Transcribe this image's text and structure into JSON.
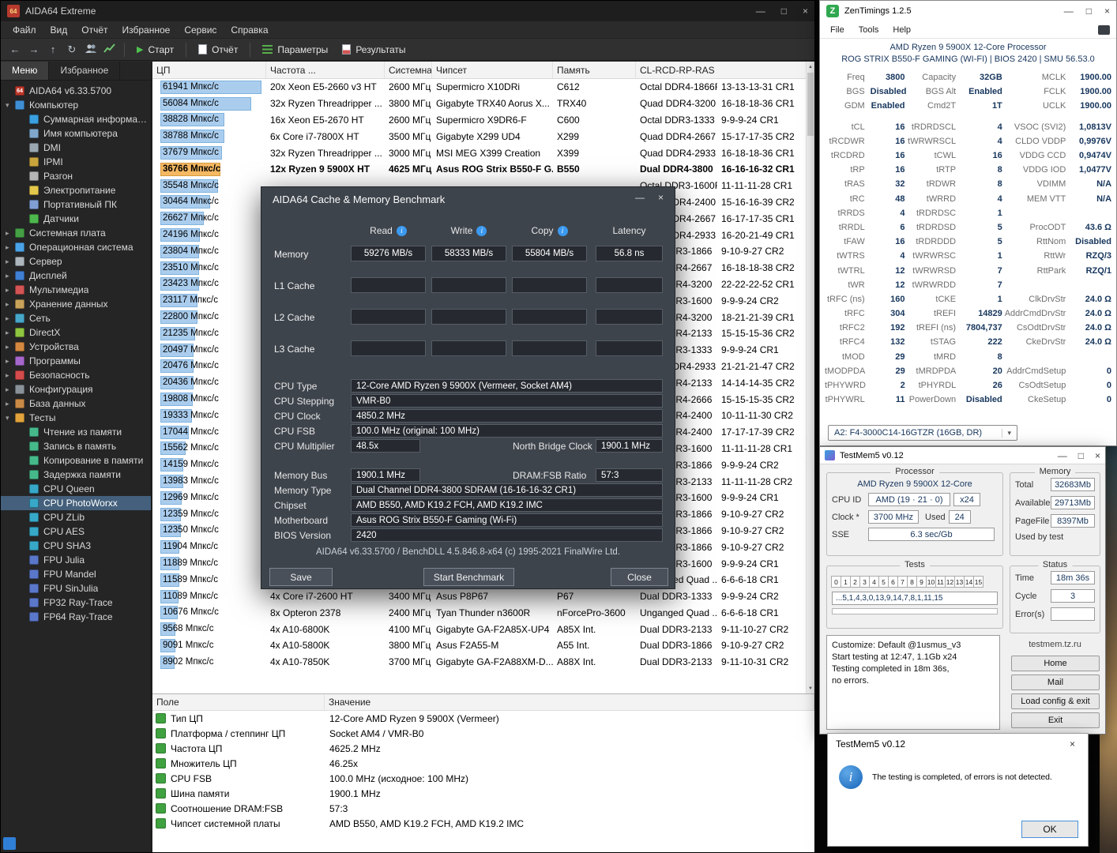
{
  "icons": {
    "minimize": "—",
    "maximize": "□",
    "close": "×",
    "back": "←",
    "forward": "→",
    "up": "↑",
    "refresh": "↻",
    "play": "▶",
    "tri_down": "▾",
    "tri_right": "▸",
    "arrow_up": "▲",
    "arrow_down": "▼",
    "info": "i",
    "chevron_down": "▾",
    "zen_logo": "Z"
  },
  "aida": {
    "logo": "64",
    "title": "AIDA64 Extreme",
    "menu": [
      "Файл",
      "Вид",
      "Отчёт",
      "Избранное",
      "Сервис",
      "Справка"
    ],
    "toolbar": {
      "start": "Старт",
      "report": "Отчёт",
      "params": "Параметры",
      "results": "Результаты"
    },
    "tabs": [
      {
        "label": "Меню"
      },
      {
        "label": "Избранное"
      }
    ],
    "tree": [
      {
        "l": "AIDA64 v6.33.5700",
        "i": "aida",
        "d": 0,
        "e": ""
      },
      {
        "l": "Компьютер",
        "i": "computer",
        "d": 0,
        "e": "v"
      },
      {
        "l": "Суммарная информация",
        "i": "summary",
        "d": 1
      },
      {
        "l": "Имя компьютера",
        "i": "name",
        "d": 1
      },
      {
        "l": "DMI",
        "i": "dmi",
        "d": 1
      },
      {
        "l": "IPMI",
        "i": "ipmi",
        "d": 1
      },
      {
        "l": "Разгон",
        "i": "oc",
        "d": 1
      },
      {
        "l": "Электропитание",
        "i": "power",
        "d": 1
      },
      {
        "l": "Портативный ПК",
        "i": "laptop",
        "d": 1
      },
      {
        "l": "Датчики",
        "i": "sensors",
        "d": 1
      },
      {
        "l": "Системная плата",
        "i": "board",
        "d": 0,
        "e": ">"
      },
      {
        "l": "Операционная система",
        "i": "os",
        "d": 0,
        "e": ">"
      },
      {
        "l": "Сервер",
        "i": "server",
        "d": 0,
        "e": ">"
      },
      {
        "l": "Дисплей",
        "i": "display",
        "d": 0,
        "e": ">"
      },
      {
        "l": "Мультимедиа",
        "i": "mm",
        "d": 0,
        "e": ">"
      },
      {
        "l": "Хранение данных",
        "i": "storage",
        "d": 0,
        "e": ">"
      },
      {
        "l": "Сеть",
        "i": "net",
        "d": 0,
        "e": ">"
      },
      {
        "l": "DirectX",
        "i": "dx",
        "d": 0,
        "e": ">"
      },
      {
        "l": "Устройства",
        "i": "dev",
        "d": 0,
        "e": ">"
      },
      {
        "l": "Программы",
        "i": "prog",
        "d": 0,
        "e": ">"
      },
      {
        "l": "Безопасность",
        "i": "sec",
        "d": 0,
        "e": ">"
      },
      {
        "l": "Конфигурация",
        "i": "cfg",
        "d": 0,
        "e": ">"
      },
      {
        "l": "База данных",
        "i": "db",
        "d": 0,
        "e": ">"
      },
      {
        "l": "Тесты",
        "i": "tests",
        "d": 0,
        "e": "v"
      },
      {
        "l": "Чтение из памяти",
        "i": "bench",
        "d": 1
      },
      {
        "l": "Запись в память",
        "i": "bench",
        "d": 1
      },
      {
        "l": "Копирование в памяти",
        "i": "bench",
        "d": 1
      },
      {
        "l": "Задержка памяти",
        "i": "bench",
        "d": 1
      },
      {
        "l": "CPU Queen",
        "i": "cpu",
        "d": 1
      },
      {
        "l": "CPU PhotoWorxx",
        "i": "cpu",
        "d": 1,
        "s": true
      },
      {
        "l": "CPU ZLib",
        "i": "cpu",
        "d": 1
      },
      {
        "l": "CPU AES",
        "i": "cpu",
        "d": 1
      },
      {
        "l": "CPU SHA3",
        "i": "cpu",
        "d": 1
      },
      {
        "l": "FPU Julia",
        "i": "fpu",
        "d": 1
      },
      {
        "l": "FPU Mandel",
        "i": "fpu",
        "d": 1
      },
      {
        "l": "FPU SinJulia",
        "i": "fpu",
        "d": 1
      },
      {
        "l": "FP32 Ray-Trace",
        "i": "fpu",
        "d": 1
      },
      {
        "l": "FP64 Ray-Trace",
        "i": "fpu",
        "d": 1
      }
    ],
    "list": {
      "columns": [
        "ЦП",
        "Частота ...",
        "Системная плата",
        "Чипсет",
        "Память",
        "CL-RCD-RP-RAS"
      ],
      "rows": [
        {
          "s": "61941 Мпкс/с",
          "p": 100,
          "c": "20x Xeon E5-2660 v3 HT",
          "f": "2600 МГц",
          "b": "Supermicro X10DRi",
          "ch": "C612",
          "m": "Octal DDR4-1866R",
          "t": "13-13-13-31 CR1"
        },
        {
          "s": "56084 Мпкс/с",
          "p": 90,
          "c": "32x Ryzen Threadripper ...",
          "f": "3800 МГц",
          "b": "Gigabyte TRX40 Aorus X...",
          "ch": "TRX40",
          "m": "Quad DDR4-3200",
          "t": "16-18-18-36 CR1"
        },
        {
          "s": "38828 Мпкс/с",
          "p": 63,
          "c": "16x Xeon E5-2670 HT",
          "f": "2600 МГц",
          "b": "Supermicro X9DR6-F",
          "ch": "C600",
          "m": "Octal DDR3-1333",
          "t": "9-9-9-24 CR1"
        },
        {
          "s": "38788 Мпкс/с",
          "p": 63,
          "c": "6x Core i7-7800X HT",
          "f": "3500 МГц",
          "b": "Gigabyte X299 UD4",
          "ch": "X299",
          "m": "Quad DDR4-2667",
          "t": "15-17-17-35 CR2"
        },
        {
          "s": "37679 Мпкс/с",
          "p": 61,
          "c": "32x Ryzen Threadripper ...",
          "f": "3000 МГц",
          "b": "MSI MEG X399 Creation",
          "ch": "X399",
          "m": "Quad DDR4-2933",
          "t": "16-18-18-36 CR1"
        },
        {
          "s": "36766 Мпкс/с",
          "p": 59,
          "cur": true,
          "c": "12x Ryzen 9 5900X HT",
          "f": "4625 МГц",
          "b": "Asus ROG Strix B550-F G...",
          "ch": "B550",
          "m": "Dual DDR4-3800",
          "t": "16-16-16-32 CR1"
        },
        {
          "s": "35548 Мпкс/с",
          "p": 57,
          "m": "Octal DDR3-1600R",
          "t": "11-11-11-28 CR1"
        },
        {
          "s": "30464 Мпкс/с",
          "p": 49,
          "m": "Quad DDR4-2400",
          "t": "15-16-16-39 CR2"
        },
        {
          "s": "26627 Мпкс/с",
          "p": 43,
          "m": "Quad DDR4-2667",
          "t": "16-17-17-35 CR1"
        },
        {
          "s": "24196 Мпкс/с",
          "p": 39,
          "m": "Quad DDR4-2933",
          "t": "16-20-21-49 CR1"
        },
        {
          "s": "23804 Мпкс/с",
          "p": 38,
          "m": "Dual DDR3-1866",
          "t": "9-10-9-27 CR2"
        },
        {
          "s": "23510 Мпкс/с",
          "p": 38,
          "m": "Dual DDR4-2667",
          "t": "16-18-18-38 CR2"
        },
        {
          "s": "23423 Мпкс/с",
          "p": 38,
          "m": "Dual DDR4-3200",
          "t": "22-22-22-52 CR1"
        },
        {
          "s": "23117 Мпкс/с",
          "p": 37,
          "m": "Dual DDR3-1600",
          "t": "9-9-9-24 CR2"
        },
        {
          "s": "22800 Мпкс/с",
          "p": 37,
          "m": "Dual DDR4-3200",
          "t": "18-21-21-39 CR1"
        },
        {
          "s": "21235 Мпкс/с",
          "p": 34,
          "m": "Dual DDR4-2133",
          "t": "15-15-15-36 CR2"
        },
        {
          "s": "20497 Мпкс/с",
          "p": 33,
          "m": "Dual DDR3-1333",
          "t": "9-9-9-24 CR1"
        },
        {
          "s": "20476 Мпкс/с",
          "p": 33,
          "m": "Quad DDR4-2933",
          "t": "21-21-21-47 CR2"
        },
        {
          "s": "20436 Мпкс/с",
          "p": 33,
          "m": "Dual DDR4-2133",
          "t": "14-14-14-35 CR2"
        },
        {
          "s": "19808 Мпкс/с",
          "p": 32,
          "m": "Dual DDR4-2666",
          "t": "15-15-15-35 CR2"
        },
        {
          "s": "19333 Мпкс/с",
          "p": 31,
          "m": "Dual DDR4-2400",
          "t": "10-11-11-30 CR2"
        },
        {
          "s": "17044 Мпкс/с",
          "p": 28,
          "m": "Dual DDR4-2400",
          "t": "17-17-17-39 CR2"
        },
        {
          "s": "15562 Мпкс/с",
          "p": 25,
          "m": "Dual DDR3-1600",
          "t": "11-11-11-28 CR1"
        },
        {
          "s": "14159 Мпкс/с",
          "p": 23,
          "m": "Dual DDR3-1866",
          "t": "9-9-9-24 CR2"
        },
        {
          "s": "13983 Мпкс/с",
          "p": 23,
          "m": "Dual DDR3-2133",
          "t": "11-11-11-28 CR2"
        },
        {
          "s": "12969 Мпкс/с",
          "p": 21,
          "m": "Dual DDR3-1600",
          "t": "9-9-9-24 CR1"
        },
        {
          "s": "12359 Мпкс/с",
          "p": 20,
          "m": "Dual DDR3-1866",
          "t": "9-10-9-27 CR2"
        },
        {
          "s": "12350 Мпкс/с",
          "p": 20,
          "m": "Dual DDR3-1866",
          "t": "9-10-9-27 CR2"
        },
        {
          "s": "11904 Мпкс/с",
          "p": 19,
          "m": "Dual DDR3-1866",
          "t": "9-10-9-27 CR2"
        },
        {
          "s": "11889 Мпкс/с",
          "p": 19,
          "m": "Dual DDR3-1600",
          "t": "9-9-9-24 CR1"
        },
        {
          "s": "11589 Мпкс/с",
          "p": 19,
          "m": "Unganged Quad ...",
          "t": "6-6-6-18 CR1"
        },
        {
          "s": "11089 Мпкс/с",
          "p": 18,
          "c": "4x Core i7-2600 HT",
          "f": "3400 МГц",
          "b": "Asus P8P67",
          "ch": "P67",
          "m": "Dual DDR3-1333",
          "t": "9-9-9-24 CR2"
        },
        {
          "s": "10676 Мпкс/с",
          "p": 17,
          "c": "8x Opteron 2378",
          "f": "2400 МГц",
          "b": "Tyan Thunder n3600R",
          "ch": "nForcePro-3600",
          "m": "Unganged Quad ...",
          "t": "6-6-6-18 CR1"
        },
        {
          "s": "9568 Мпкс/с",
          "p": 15,
          "c": "4x A10-6800K",
          "f": "4100 МГц",
          "b": "Gigabyte GA-F2A85X-UP4",
          "ch": "A85X Int.",
          "m": "Dual DDR3-2133",
          "t": "9-11-10-27 CR2"
        },
        {
          "s": "9091 Мпкс/с",
          "p": 15,
          "c": "4x A10-5800K",
          "f": "3800 МГц",
          "b": "Asus F2A55-M",
          "ch": "A55 Int.",
          "m": "Dual DDR3-1866",
          "t": "9-10-9-27 CR2"
        },
        {
          "s": "8902 Мпкс/с",
          "p": 14,
          "c": "4x A10-7850K",
          "f": "3700 МГц",
          "b": "Gigabyte GA-F2A88XM-D...",
          "ch": "A88X Int.",
          "m": "Dual DDR3-2133",
          "t": "9-11-10-31 CR2"
        }
      ]
    },
    "bottom": {
      "columns": [
        "Поле",
        "Значение"
      ],
      "rows": [
        [
          "Тип ЦП",
          "12-Core AMD Ryzen 9 5900X  (Vermeer)"
        ],
        [
          "Платформа / степпинг ЦП",
          "Socket AM4 / VMR-B0"
        ],
        [
          "Частота ЦП",
          "4625.2 MHz"
        ],
        [
          "Множитель ЦП",
          "46.25x"
        ],
        [
          "CPU FSB",
          "100.0 MHz  (исходное: 100 MHz)"
        ],
        [
          "Шина памяти",
          "1900.1 MHz"
        ],
        [
          "Соотношение DRAM:FSB",
          "57:3"
        ],
        [
          "Чипсет системной платы",
          "AMD B550, AMD K19.2 FCH, AMD K19.2 IMC"
        ]
      ]
    }
  },
  "bench": {
    "title": "AIDA64 Cache & Memory Benchmark",
    "headers": {
      "read": "Read",
      "write": "Write",
      "copy": "Copy",
      "latency": "Latency"
    },
    "mem_row": {
      "label": "Memory",
      "read": "59276 MB/s",
      "write": "58333 MB/s",
      "copy": "55804 MB/s",
      "latency": "56.8 ns"
    },
    "l1": {
      "label": "L1 Cache"
    },
    "l2": {
      "label": "L2 Cache"
    },
    "l3": {
      "label": "L3 Cache"
    },
    "info": {
      "cpu_type": [
        "CPU Type",
        "12-Core AMD Ryzen 9 5900X  (Vermeer, Socket AM4)"
      ],
      "stepping": [
        "CPU Stepping",
        "VMR-B0"
      ],
      "clock": [
        "CPU Clock",
        "4850.2 MHz"
      ],
      "fsb": [
        "CPU FSB",
        "100.0 MHz  (original: 100 MHz)"
      ],
      "mult": [
        "CPU Multiplier",
        "48.5x"
      ],
      "nb": [
        "North Bridge Clock",
        "1900.1 MHz"
      ],
      "membus": [
        "Memory Bus",
        "1900.1 MHz"
      ],
      "ratio": [
        "DRAM:FSB Ratio",
        "57:3"
      ],
      "memtype": [
        "Memory Type",
        "Dual Channel DDR4-3800 SDRAM  (16-16-16-32 CR1)"
      ],
      "chipset": [
        "Chipset",
        "AMD B550, AMD K19.2 FCH, AMD K19.2 IMC"
      ],
      "mobo": [
        "Motherboard",
        "Asus ROG Strix B550-F Gaming (Wi-Fi)"
      ],
      "bios": [
        "BIOS Version",
        "2420"
      ]
    },
    "footer": "AIDA64 v6.33.5700 / BenchDLL 4.5.846.8-x64  (c) 1995-2021 FinalWire Ltd.",
    "save": "Save",
    "start": "Start Benchmark",
    "close": "Close"
  },
  "zen": {
    "title": "ZenTimings 1.2.5",
    "menu": [
      "File",
      "Tools",
      "Help"
    ],
    "cpu_line": "AMD Ryzen 9 5900X 12-Core Processor",
    "board_line": "ROG STRIX B550-F GAMING (WI-FI) | BIOS 2420 | SMU 56.53.0",
    "rows": [
      [
        "Freq",
        "3800",
        "Capacity",
        "32GB",
        "MCLK",
        "1900.00"
      ],
      [
        "BGS",
        "Disabled",
        "BGS Alt",
        "Enabled",
        "FCLK",
        "1900.00"
      ],
      [
        "GDM",
        "Enabled",
        "Cmd2T",
        "1T",
        "UCLK",
        "1900.00"
      ],
      [
        "",
        "",
        "",
        "",
        "",
        ""
      ],
      [
        "tCL",
        "16",
        "tRDRDSCL",
        "4",
        "VSOC (SVI2)",
        "1,0813V"
      ],
      [
        "tRCDWR",
        "16",
        "tWRWRSCL",
        "4",
        "CLDO VDDP",
        "0,9976V"
      ],
      [
        "tRCDRD",
        "16",
        "tCWL",
        "16",
        "VDDG CCD",
        "0,9474V"
      ],
      [
        "tRP",
        "16",
        "tRTP",
        "8",
        "VDDG IOD",
        "1,0477V"
      ],
      [
        "tRAS",
        "32",
        "tRDWR",
        "8",
        "VDIMM",
        "N/A"
      ],
      [
        "tRC",
        "48",
        "tWRRD",
        "4",
        "MEM VTT",
        "N/A"
      ],
      [
        "tRRDS",
        "4",
        "tRDRDSC",
        "1",
        "",
        ""
      ],
      [
        "tRRDL",
        "6",
        "tRDRDSD",
        "5",
        "ProcODT",
        "43.6 Ω"
      ],
      [
        "tFAW",
        "16",
        "tRDRDDD",
        "5",
        "RttNom",
        "Disabled"
      ],
      [
        "tWTRS",
        "4",
        "tWRWRSC",
        "1",
        "RttWr",
        "RZQ/3"
      ],
      [
        "tWTRL",
        "12",
        "tWRWRSD",
        "7",
        "RttPark",
        "RZQ/1"
      ],
      [
        "tWR",
        "12",
        "tWRWRDD",
        "7",
        "",
        ""
      ],
      [
        "tRFC (ns)",
        "160",
        "tCKE",
        "1",
        "ClkDrvStr",
        "24.0 Ω"
      ],
      [
        "tRFC",
        "304",
        "tREFI",
        "14829",
        "AddrCmdDrvStr",
        "24.0 Ω"
      ],
      [
        "tRFC2",
        "192",
        "tREFI (ns)",
        "7804,737",
        "CsOdtDrvStr",
        "24.0 Ω"
      ],
      [
        "tRFC4",
        "132",
        "tSTAG",
        "222",
        "CkeDrvStr",
        "24.0 Ω"
      ],
      [
        "tMOD",
        "29",
        "tMRD",
        "8",
        "",
        ""
      ],
      [
        "tMODPDA",
        "29",
        "tMRDPDA",
        "20",
        "AddrCmdSetup",
        "0"
      ],
      [
        "tPHYWRD",
        "2",
        "tPHYRDL",
        "26",
        "CsOdtSetup",
        "0"
      ],
      [
        "tPHYWRL",
        "11",
        "PowerDown",
        "Disabled",
        "CkeSetup",
        "0"
      ]
    ],
    "dimm": "A2: F4-3000C14-16GTZR (16GB, DR)"
  },
  "tm5": {
    "title": "TestMem5 v0.12",
    "groups": {
      "processor": "Processor",
      "memory": "Memory",
      "tests": "Tests",
      "status": "Status"
    },
    "processor": {
      "name": "AMD Ryzen 9 5900X 12-Core",
      "cpu_id_label": "CPU ID",
      "cpu_id": "AMD (19 · 21 · 0)",
      "cpu_x": "x24",
      "clock_label": "Clock *",
      "clock": "3700 MHz",
      "used_label": "Used",
      "used": "24",
      "sse_label": "SSE",
      "sse": "6.3 sec/Gb"
    },
    "memory": {
      "rows": [
        [
          "Total",
          "32683Mb"
        ],
        [
          "Available",
          "29713Mb"
        ],
        [
          "PageFile",
          "8397Mb"
        ],
        [
          "Used by test",
          ""
        ]
      ]
    },
    "tests": {
      "digits": [
        "0",
        "1",
        "2",
        "3",
        "4",
        "5",
        "6",
        "7",
        "8",
        "9",
        "10",
        "11",
        "12",
        "13",
        "14",
        "15"
      ],
      "sequence": "...5,1,4,3,0,13,9,14,7,8,1,11,15"
    },
    "status": {
      "rows": [
        [
          "Time",
          "18m 36s"
        ],
        [
          "Cycle",
          "3"
        ],
        [
          "Error(s)",
          ""
        ]
      ]
    },
    "log": [
      "Customize: Default @1usmus_v3",
      "Start testing at 12:47, 1.1Gb x24",
      "Testing completed in 18m 36s,",
      "no errors."
    ],
    "site": "testmem.tz.ru",
    "buttons": [
      "Home",
      "Mail",
      "Load config & exit",
      "Exit"
    ]
  },
  "tm5_dialog": {
    "title": "TestMem5 v0.12",
    "message": "The testing is completed, of errors is not detected.",
    "ok": "OK"
  }
}
